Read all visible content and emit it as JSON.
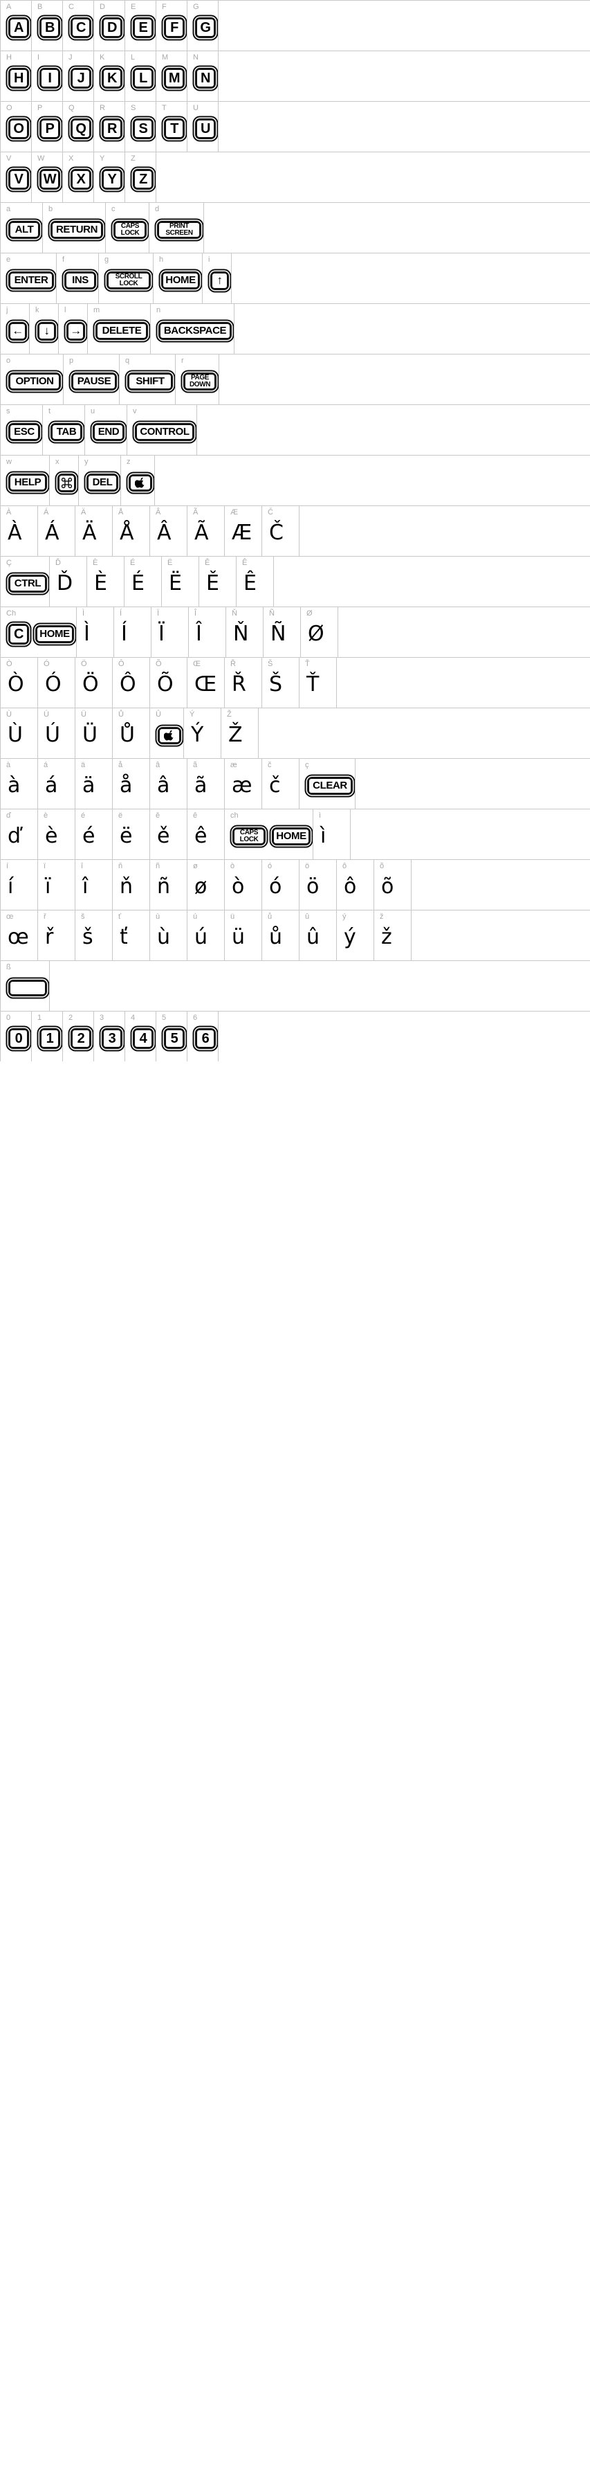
{
  "meta": {
    "title": "Keycaps font character map",
    "label_color": "#a9a9a9",
    "grid_color": "#c8c8c8",
    "glyph_color": "#000000",
    "background": "#ffffff"
  },
  "rows": [
    {
      "id": "row-upper-1",
      "cells": [
        {
          "name": "A",
          "kind": "key-square",
          "label": "A"
        },
        {
          "name": "B",
          "kind": "key-square",
          "label": "B"
        },
        {
          "name": "C",
          "kind": "key-square",
          "label": "C"
        },
        {
          "name": "D",
          "kind": "key-square",
          "label": "D"
        },
        {
          "name": "E",
          "kind": "key-square",
          "label": "E"
        },
        {
          "name": "F",
          "kind": "key-square",
          "label": "F"
        },
        {
          "name": "G",
          "kind": "key-square",
          "label": "G"
        }
      ]
    },
    {
      "id": "row-upper-2",
      "cells": [
        {
          "name": "H",
          "kind": "key-square",
          "label": "H"
        },
        {
          "name": "I",
          "kind": "key-square",
          "label": "I"
        },
        {
          "name": "J",
          "kind": "key-square",
          "label": "J"
        },
        {
          "name": "K",
          "kind": "key-square",
          "label": "K"
        },
        {
          "name": "L",
          "kind": "key-square",
          "label": "L"
        },
        {
          "name": "M",
          "kind": "key-square",
          "label": "M"
        },
        {
          "name": "N",
          "kind": "key-square",
          "label": "N"
        }
      ]
    },
    {
      "id": "row-upper-3",
      "cells": [
        {
          "name": "O",
          "kind": "key-square",
          "label": "O"
        },
        {
          "name": "P",
          "kind": "key-square",
          "label": "P"
        },
        {
          "name": "Q",
          "kind": "key-square",
          "label": "Q"
        },
        {
          "name": "R",
          "kind": "key-square",
          "label": "R"
        },
        {
          "name": "S",
          "kind": "key-square",
          "label": "S"
        },
        {
          "name": "T",
          "kind": "key-square",
          "label": "T"
        },
        {
          "name": "U",
          "kind": "key-square",
          "label": "U"
        }
      ]
    },
    {
      "id": "row-upper-4",
      "cells": [
        {
          "name": "V",
          "kind": "key-square",
          "label": "V"
        },
        {
          "name": "W",
          "kind": "key-square",
          "label": "W"
        },
        {
          "name": "X",
          "kind": "key-square",
          "label": "X"
        },
        {
          "name": "Y",
          "kind": "key-square",
          "label": "Y"
        },
        {
          "name": "Z",
          "kind": "key-square",
          "label": "Z"
        }
      ]
    },
    {
      "id": "row-lower-1",
      "cells": [
        {
          "name": "a",
          "kind": "key-wide",
          "label": "ALT"
        },
        {
          "name": "b",
          "kind": "key-wide",
          "label": "RETURN"
        },
        {
          "name": "c",
          "kind": "key-stack",
          "label": "CAPS\nLOCK"
        },
        {
          "name": "d",
          "kind": "key-stack",
          "label": "PRINT\nSCREEN"
        }
      ]
    },
    {
      "id": "row-lower-2",
      "cells": [
        {
          "name": "e",
          "kind": "key-wide",
          "label": "ENTER"
        },
        {
          "name": "f",
          "kind": "key-wide",
          "label": "INS"
        },
        {
          "name": "g",
          "kind": "key-stack",
          "label": "SCROLL\nLOCK"
        },
        {
          "name": "h",
          "kind": "key-wide",
          "label": "HOME"
        },
        {
          "name": "i",
          "kind": "key-symbol",
          "label": "↑"
        }
      ]
    },
    {
      "id": "row-lower-3",
      "cells": [
        {
          "name": "j",
          "kind": "key-symbol",
          "label": "←"
        },
        {
          "name": "k",
          "kind": "key-symbol",
          "label": "↓"
        },
        {
          "name": "l",
          "kind": "key-symbol",
          "label": "→"
        },
        {
          "name": "m",
          "kind": "key-wide",
          "label": "DELETE"
        },
        {
          "name": "n",
          "kind": "key-wide",
          "label": "BACKSPACE"
        }
      ]
    },
    {
      "id": "row-lower-4",
      "cells": [
        {
          "name": "o",
          "kind": "key-wide",
          "label": "OPTION"
        },
        {
          "name": "p",
          "kind": "key-wide",
          "label": "PAUSE"
        },
        {
          "name": "q",
          "kind": "key-wide",
          "label": "SHIFT"
        },
        {
          "name": "r",
          "kind": "key-stack",
          "label": "PAGE\nDOWN"
        }
      ]
    },
    {
      "id": "row-lower-5",
      "cells": [
        {
          "name": "s",
          "kind": "key-wide",
          "label": "ESC"
        },
        {
          "name": "t",
          "kind": "key-wide",
          "label": "TAB"
        },
        {
          "name": "u",
          "kind": "key-wide",
          "label": "END"
        },
        {
          "name": "v",
          "kind": "key-wide",
          "label": "CONTROL"
        }
      ]
    },
    {
      "id": "row-lower-6",
      "cells": [
        {
          "name": "w",
          "kind": "key-wide",
          "label": "HELP"
        },
        {
          "name": "x",
          "kind": "key-symbol",
          "label": "⌘"
        },
        {
          "name": "y",
          "kind": "key-wide",
          "label": "DEL"
        },
        {
          "name": "z",
          "kind": "key-apple",
          "label": "●"
        }
      ]
    },
    {
      "id": "row-accent-1",
      "cells": [
        {
          "name": "À",
          "kind": "glyph",
          "label": "À"
        },
        {
          "name": "Á",
          "kind": "glyph",
          "label": "Á"
        },
        {
          "name": "Ä",
          "kind": "glyph",
          "label": "Ä"
        },
        {
          "name": "Å",
          "kind": "glyph",
          "label": "Å"
        },
        {
          "name": "Â",
          "kind": "glyph",
          "label": "Â"
        },
        {
          "name": "Ã",
          "kind": "glyph",
          "label": "Ã"
        },
        {
          "name": "Æ",
          "kind": "glyph",
          "label": "Æ"
        },
        {
          "name": "Č",
          "kind": "glyph",
          "label": "Č"
        }
      ]
    },
    {
      "id": "row-accent-2",
      "cells": [
        {
          "name": "Ç",
          "kind": "key-wide",
          "label": "CTRL"
        },
        {
          "name": "Ď",
          "kind": "glyph",
          "label": "Ď"
        },
        {
          "name": "È",
          "kind": "glyph",
          "label": "È"
        },
        {
          "name": "É",
          "kind": "glyph",
          "label": "É"
        },
        {
          "name": "Ë",
          "kind": "glyph",
          "label": "Ë"
        },
        {
          "name": "Ě",
          "kind": "glyph",
          "label": "Ě"
        },
        {
          "name": "Ê",
          "kind": "glyph",
          "label": "Ê"
        }
      ]
    },
    {
      "id": "row-accent-3",
      "cells": [
        {
          "name": "Ch",
          "kind": "key-pair",
          "label": "C",
          "label2": "HOME"
        },
        {
          "name": "Ì",
          "kind": "glyph",
          "label": "Ì"
        },
        {
          "name": "Í",
          "kind": "glyph",
          "label": "Í"
        },
        {
          "name": "Ï",
          "kind": "glyph",
          "label": "Ï"
        },
        {
          "name": "Î",
          "kind": "glyph",
          "label": "Î"
        },
        {
          "name": "Ň",
          "kind": "glyph",
          "label": "Ň"
        },
        {
          "name": "Ñ",
          "kind": "glyph",
          "label": "Ñ"
        },
        {
          "name": "Ø",
          "kind": "glyph",
          "label": "Ø"
        }
      ]
    },
    {
      "id": "row-accent-4",
      "cells": [
        {
          "name": "Ò",
          "kind": "glyph",
          "label": "Ò"
        },
        {
          "name": "Ó",
          "kind": "glyph",
          "label": "Ó"
        },
        {
          "name": "Ö",
          "kind": "glyph",
          "label": "Ö"
        },
        {
          "name": "Ô",
          "kind": "glyph",
          "label": "Ô"
        },
        {
          "name": "Õ",
          "kind": "glyph",
          "label": "Õ"
        },
        {
          "name": "Œ",
          "kind": "glyph",
          "label": "Œ"
        },
        {
          "name": "Ř",
          "kind": "glyph",
          "label": "Ř"
        },
        {
          "name": "Š",
          "kind": "glyph",
          "label": "Š"
        },
        {
          "name": "Ť",
          "kind": "glyph",
          "label": "Ť"
        }
      ]
    },
    {
      "id": "row-accent-5",
      "cells": [
        {
          "name": "Ù",
          "kind": "glyph",
          "label": "Ù"
        },
        {
          "name": "Ú",
          "kind": "glyph",
          "label": "Ú"
        },
        {
          "name": "Ü",
          "kind": "glyph",
          "label": "Ü"
        },
        {
          "name": "Ů",
          "kind": "glyph",
          "label": "Ů"
        },
        {
          "name": "Û",
          "kind": "key-apple",
          "label": "●"
        },
        {
          "name": "Ý",
          "kind": "glyph",
          "label": "Ý"
        },
        {
          "name": "Ž",
          "kind": "glyph",
          "label": "Ž"
        }
      ]
    },
    {
      "id": "row-low-accent-1",
      "cells": [
        {
          "name": "à",
          "kind": "glyph",
          "label": "à"
        },
        {
          "name": "á",
          "kind": "glyph",
          "label": "á"
        },
        {
          "name": "ä",
          "kind": "glyph",
          "label": "ä"
        },
        {
          "name": "å",
          "kind": "glyph",
          "label": "å"
        },
        {
          "name": "â",
          "kind": "glyph",
          "label": "â"
        },
        {
          "name": "ã",
          "kind": "glyph",
          "label": "ã"
        },
        {
          "name": "æ",
          "kind": "glyph",
          "label": "æ"
        },
        {
          "name": "č",
          "kind": "glyph",
          "label": "č"
        },
        {
          "name": "ç",
          "kind": "key-wide",
          "label": "CLEAR"
        }
      ]
    },
    {
      "id": "row-low-accent-2",
      "cells": [
        {
          "name": "ď",
          "kind": "glyph",
          "label": "ď"
        },
        {
          "name": "è",
          "kind": "glyph",
          "label": "è"
        },
        {
          "name": "é",
          "kind": "glyph",
          "label": "é"
        },
        {
          "name": "ë",
          "kind": "glyph",
          "label": "ë"
        },
        {
          "name": "ě",
          "kind": "glyph",
          "label": "ě"
        },
        {
          "name": "ê",
          "kind": "glyph",
          "label": "ê"
        },
        {
          "name": "ch",
          "kind": "key-pair-stack",
          "label": "CAPS\nLOCK",
          "label2": "HOME"
        },
        {
          "name": "ì",
          "kind": "glyph",
          "label": "ì"
        }
      ]
    },
    {
      "id": "row-low-accent-3",
      "cells": [
        {
          "name": "í",
          "kind": "glyph",
          "label": "í"
        },
        {
          "name": "ï",
          "kind": "glyph",
          "label": "ï"
        },
        {
          "name": "î",
          "kind": "glyph",
          "label": "î"
        },
        {
          "name": "ň",
          "kind": "glyph",
          "label": "ň"
        },
        {
          "name": "ñ",
          "kind": "glyph",
          "label": "ñ"
        },
        {
          "name": "ø",
          "kind": "glyph",
          "label": "ø"
        },
        {
          "name": "ò",
          "kind": "glyph",
          "label": "ò"
        },
        {
          "name": "ó",
          "kind": "glyph",
          "label": "ó"
        },
        {
          "name": "ö",
          "kind": "glyph",
          "label": "ö"
        },
        {
          "name": "ô",
          "kind": "glyph",
          "label": "ô"
        },
        {
          "name": "õ",
          "kind": "glyph",
          "label": "õ"
        }
      ]
    },
    {
      "id": "row-low-accent-4",
      "cells": [
        {
          "name": "œ",
          "kind": "glyph",
          "label": "œ"
        },
        {
          "name": "ř",
          "kind": "glyph",
          "label": "ř"
        },
        {
          "name": "š",
          "kind": "glyph",
          "label": "š"
        },
        {
          "name": "ť",
          "kind": "glyph",
          "label": "ť"
        },
        {
          "name": "ù",
          "kind": "glyph",
          "label": "ù"
        },
        {
          "name": "ú",
          "kind": "glyph",
          "label": "ú"
        },
        {
          "name": "ü",
          "kind": "glyph",
          "label": "ü"
        },
        {
          "name": "ů",
          "kind": "glyph",
          "label": "ů"
        },
        {
          "name": "û",
          "kind": "glyph",
          "label": "û"
        },
        {
          "name": "ý",
          "kind": "glyph",
          "label": "ý"
        },
        {
          "name": "ž",
          "kind": "glyph",
          "label": "ž"
        }
      ]
    },
    {
      "id": "row-blank",
      "cells": [
        {
          "name": "ß",
          "kind": "key-blank",
          "label": ""
        }
      ]
    },
    {
      "id": "row-digits",
      "cells": [
        {
          "name": "0",
          "kind": "key-square",
          "label": "0"
        },
        {
          "name": "1",
          "kind": "key-square",
          "label": "1"
        },
        {
          "name": "2",
          "kind": "key-square",
          "label": "2"
        },
        {
          "name": "3",
          "kind": "key-square",
          "label": "3"
        },
        {
          "name": "4",
          "kind": "key-square",
          "label": "4"
        },
        {
          "name": "5",
          "kind": "key-square",
          "label": "5"
        },
        {
          "name": "6",
          "kind": "key-square",
          "label": "6"
        }
      ]
    }
  ]
}
